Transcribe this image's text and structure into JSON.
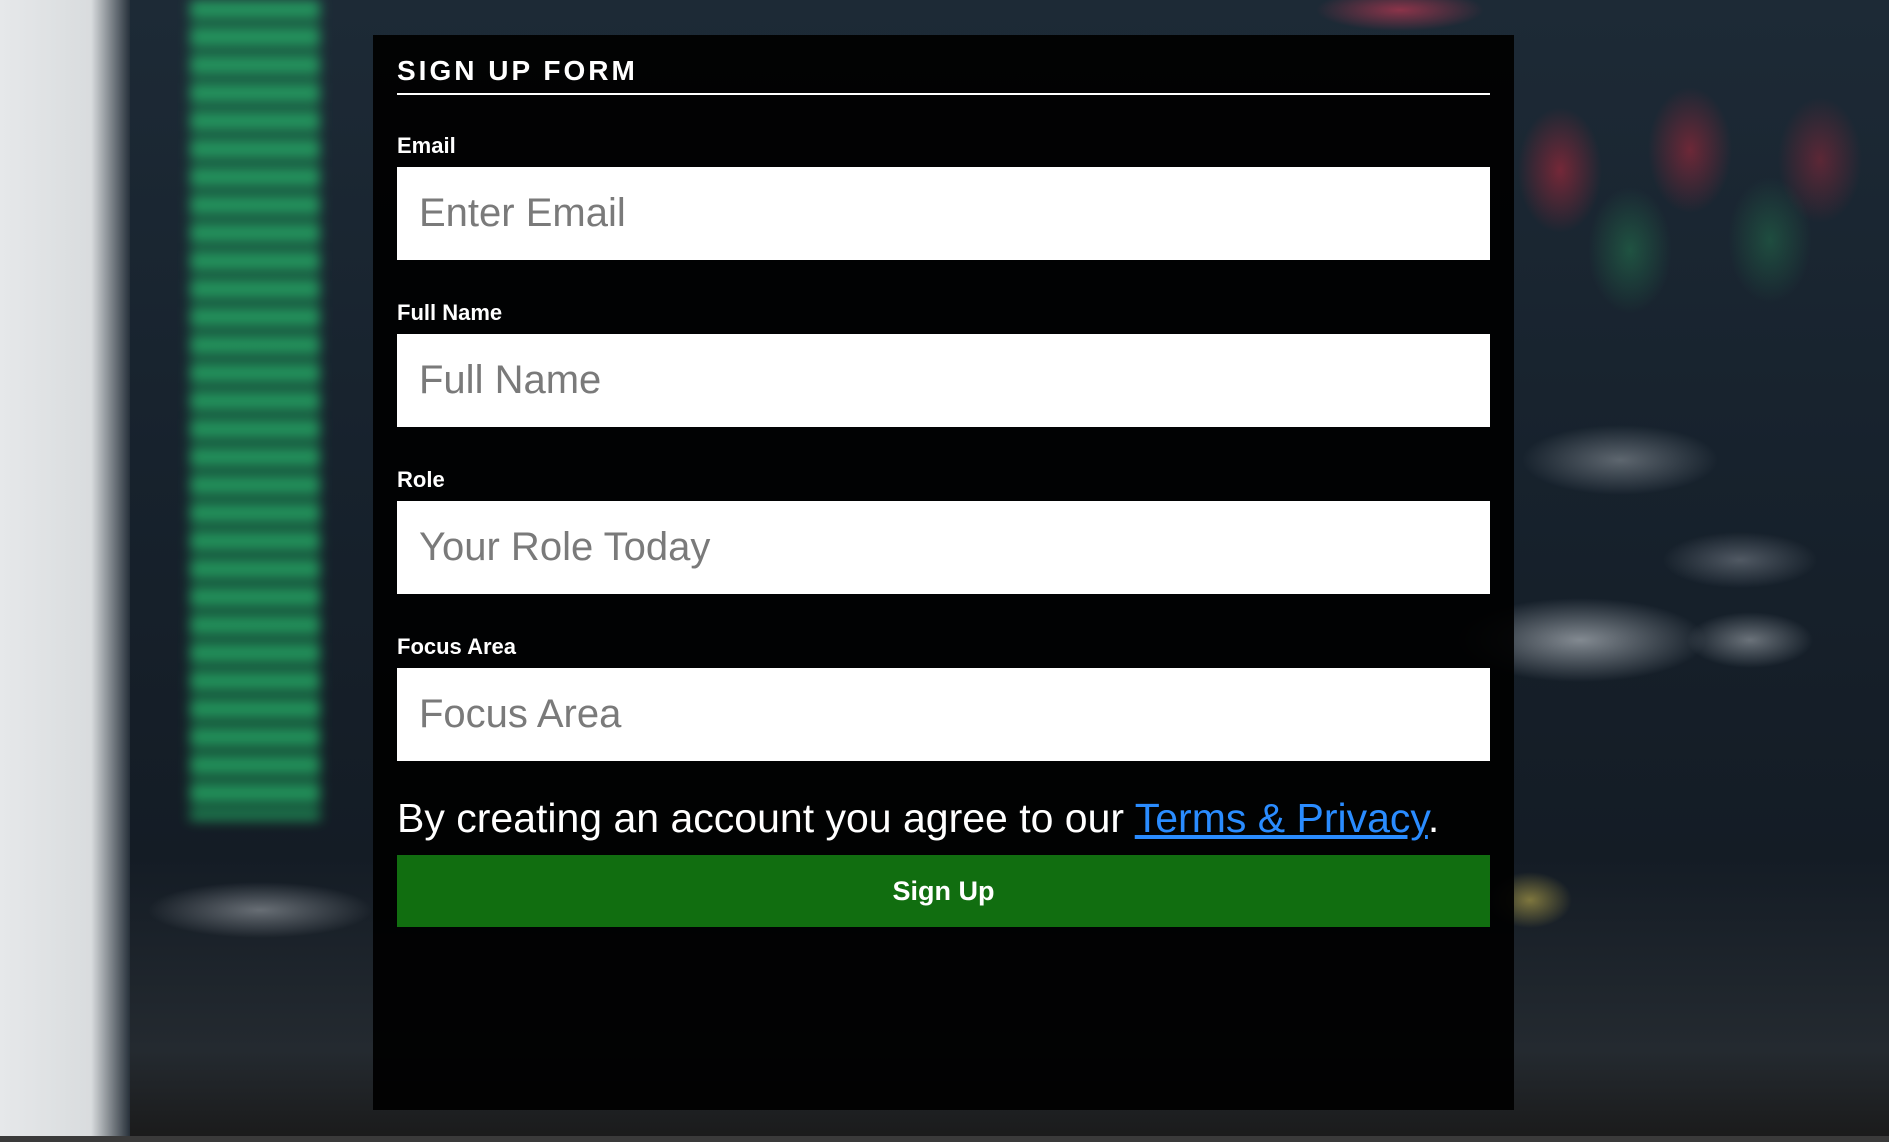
{
  "form": {
    "title": "SIGN UP FORM",
    "fields": [
      {
        "label": "Email",
        "placeholder": "Enter Email",
        "value": ""
      },
      {
        "label": "Full Name",
        "placeholder": "Full Name",
        "value": ""
      },
      {
        "label": "Role",
        "placeholder": "Your Role Today",
        "value": ""
      },
      {
        "label": "Focus Area",
        "placeholder": "Focus Area",
        "value": ""
      }
    ],
    "agreement": {
      "text": "By creating an account you agree to our ",
      "link_text": "Terms & Privacy",
      "suffix": "."
    },
    "submit_label": "Sign Up"
  },
  "colors": {
    "panel_background": "#000000",
    "submit_button": "#116e10",
    "link": "#2a8cff"
  }
}
